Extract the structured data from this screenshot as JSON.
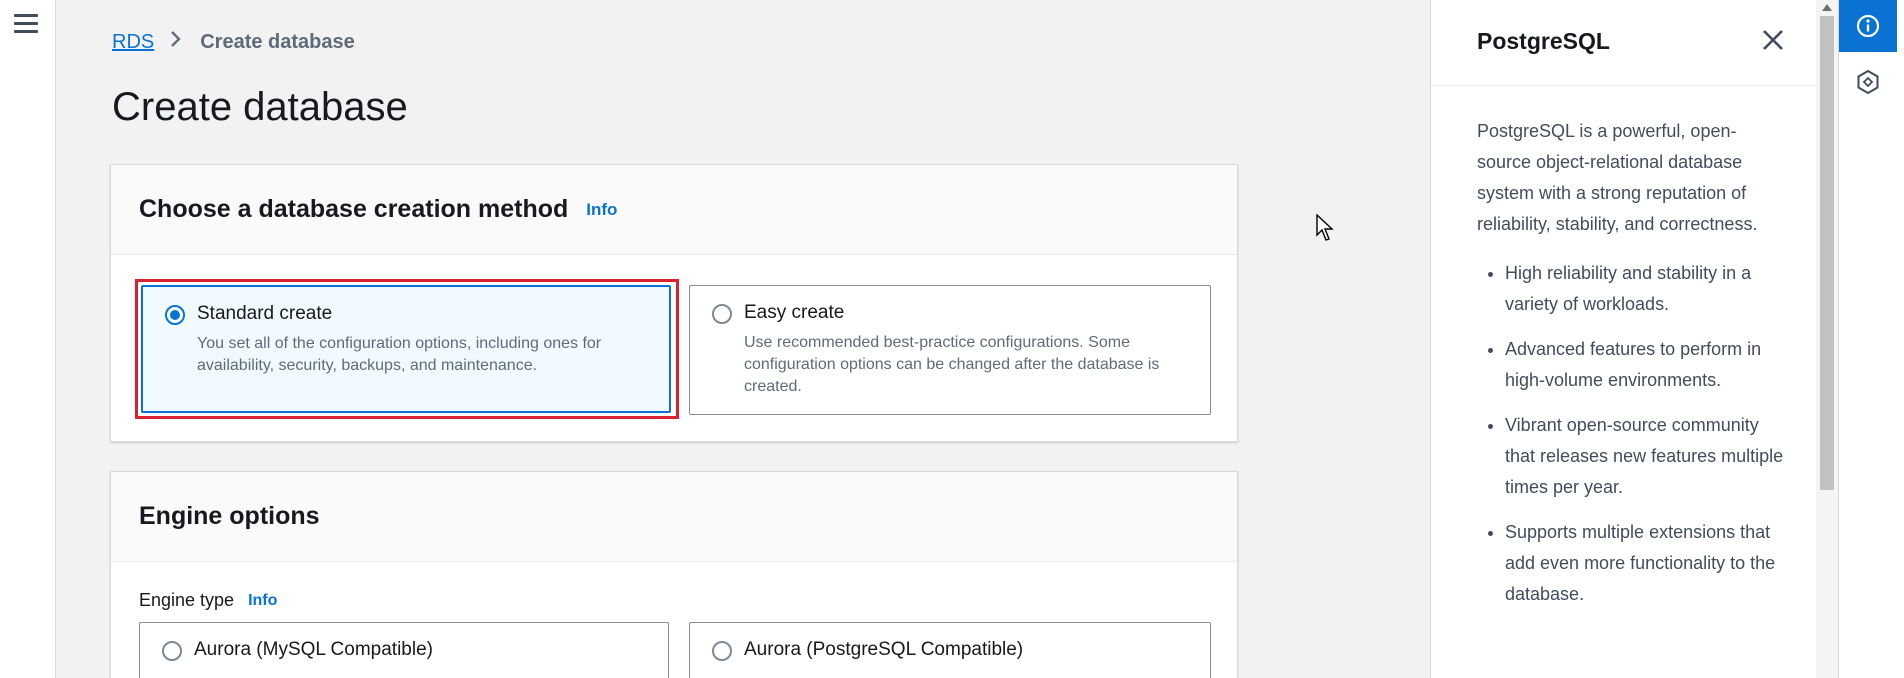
{
  "breadcrumb": {
    "root": "RDS",
    "current": "Create database"
  },
  "page": {
    "title": "Create database"
  },
  "creation_method": {
    "title": "Choose a database creation method",
    "info": "Info",
    "options": [
      {
        "label": "Standard create",
        "description": "You set all of the configuration options, including ones for availability, security, backups, and maintenance.",
        "selected": true
      },
      {
        "label": "Easy create",
        "description": "Use recommended best-practice configurations. Some configuration options can be changed after the database is created.",
        "selected": false
      }
    ]
  },
  "engine_options": {
    "title": "Engine options",
    "engine_type_label": "Engine type",
    "info": "Info",
    "options": [
      {
        "label": "Aurora (MySQL Compatible)",
        "selected": false
      },
      {
        "label": "Aurora (PostgreSQL Compatible)",
        "selected": false
      }
    ]
  },
  "help_panel": {
    "title": "PostgreSQL",
    "intro": "PostgreSQL is a powerful, open-source object-relational database system with a strong reputation of reliability, stability, and correctness.",
    "bullets": [
      "High reliability and stability in a variety of workloads.",
      "Advanced features to perform in high-volume environments.",
      "Vibrant open-source community that releases new features multiple times per year.",
      "Supports multiple extensions that add even more functionality to the database."
    ]
  },
  "icons": {
    "menu": "hamburger-menu-icon",
    "close": "close-icon",
    "info": "info-circle-icon",
    "second_util": "hexagon-icon"
  },
  "colors": {
    "accent": "#0972d3",
    "highlight": "#d9212f"
  }
}
